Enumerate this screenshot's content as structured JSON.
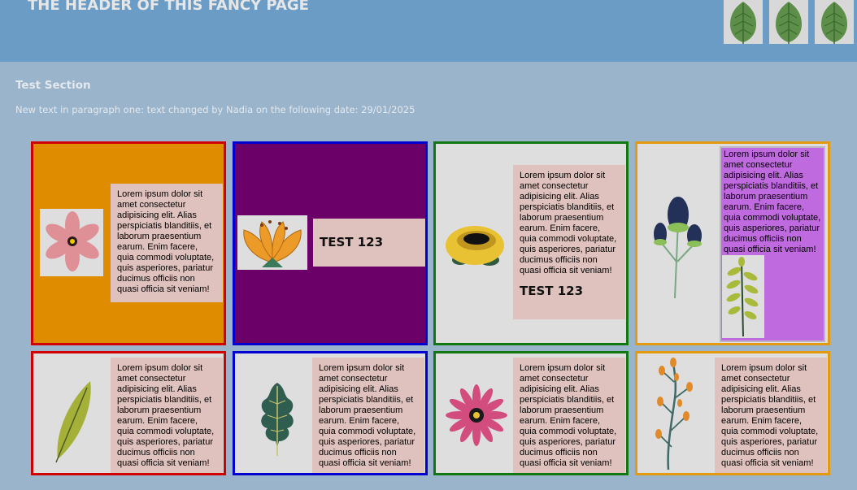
{
  "header": {
    "title": "THE HEADER OF THIS FANCY PAGE",
    "leaf_icons": [
      "leaf-icon",
      "leaf-icon",
      "leaf-icon"
    ]
  },
  "section": {
    "title": "Test Section",
    "paragraph": "New text in paragraph one: text changed by Nadia on the following date: 29/01/2025"
  },
  "lorem": "Lorem ipsum dolor sit amet consectetur adipisicing elit. Alias perspiciatis blanditiis, et laborum praesentium earum. Enim facere, quia commodi voluptate, quis asperiores, pariatur ducimus officiis non quasi officia sit veniam!",
  "test_label": "TEST 123",
  "colors": {
    "header_bg": "#6b9cc6",
    "section_bg": "#9ab4cc",
    "red": "#d00000",
    "blue": "#0000d0",
    "green": "#117711",
    "orange": "#e49a10",
    "purple": "#6b0068",
    "text_box": "#dfc2bd",
    "lavender": "#c06ae0"
  },
  "cards": [
    {
      "icon": "pink-flower-icon",
      "text": "Lorem ipsum dolor sit amet consectetur adipisicing elit. Alias perspiciatis blanditiis, et laborum praesentium earum. Enim facere, quia commodi voluptate, quis asperiores, pariatur ducimus officiis non quasi officia sit veniam!"
    },
    {
      "icon": "orange-flower-icon",
      "text": "TEST 123"
    },
    {
      "icon": "yellow-flower-icon",
      "text": "Lorem ipsum dolor sit amet consectetur adipisicing elit. Alias perspiciatis blanditiis, et laborum praesentium earum. Enim facere, quia commodi voluptate, quis asperiores, pariatur ducimus officiis non quasi officia sit veniam!",
      "label": "TEST 123"
    },
    {
      "icon": "thistle-icon",
      "text": "Lorem ipsum dolor sit amet consectetur adipisicing elit. Alias perspiciatis blanditiis, et laborum praesentium earum. Enim facere, quia commodi voluptate, quis asperiores, pariatur ducimus officiis non quasi officia sit veniam!",
      "sub_icon": "fern-icon"
    },
    {
      "icon": "leaf-icon",
      "text": "Lorem ipsum dolor sit amet consectetur adipisicing elit. Alias perspiciatis blanditiis, et laborum praesentium earum. Enim facere, quia commodi voluptate, quis asperiores, pariatur ducimus officiis non quasi officia sit veniam!"
    },
    {
      "icon": "oak-leaf-icon",
      "text": "Lorem ipsum dolor sit amet consectetur adipisicing elit. Alias perspiciatis blanditiis, et laborum praesentium earum. Enim facere, quia commodi voluptate, quis asperiores, pariatur ducimus officiis non quasi officia sit veniam!"
    },
    {
      "icon": "daisy-icon",
      "text": "Lorem ipsum dolor sit amet consectetur adipisicing elit. Alias perspiciatis blanditiis, et laborum praesentium earum. Enim facere, quia commodi voluptate, quis asperiores, pariatur ducimus officiis non quasi officia sit veniam!"
    },
    {
      "icon": "berry-branch-icon",
      "text": "Lorem ipsum dolor sit amet consectetur adipisicing elit. Alias perspiciatis blanditiis, et laborum praesentium earum. Enim facere, quia commodi voluptate, quis asperiores, pariatur ducimus officiis non quasi officia sit veniam!"
    }
  ]
}
